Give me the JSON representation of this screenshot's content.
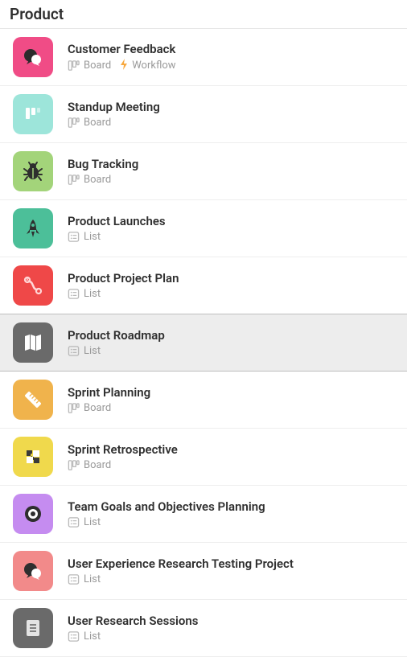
{
  "section_title": "Product",
  "view_labels": {
    "board": "Board",
    "list": "List",
    "workflow": "Workflow"
  },
  "items": [
    {
      "title": "Customer Feedback",
      "view": "board",
      "workflow": true,
      "icon": "chat-bubbles",
      "bg": "#f04c86",
      "fg": "#2b2b2b",
      "selected": false
    },
    {
      "title": "Standup Meeting",
      "view": "board",
      "workflow": false,
      "icon": "kanban-columns",
      "bg": "#9de5da",
      "fg": "#ffffff",
      "selected": false
    },
    {
      "title": "Bug Tracking",
      "view": "board",
      "workflow": false,
      "icon": "bug",
      "bg": "#a3d47a",
      "fg": "#2e2e2e",
      "selected": false
    },
    {
      "title": "Product Launches",
      "view": "list",
      "workflow": false,
      "icon": "rocket",
      "bg": "#4cbf99",
      "fg": "#2e2e2e",
      "selected": false
    },
    {
      "title": "Product Project Plan",
      "view": "list",
      "workflow": false,
      "icon": "merge-path",
      "bg": "#ef4848",
      "fg": "#ffd7d7",
      "selected": false
    },
    {
      "title": "Product Roadmap",
      "view": "list",
      "workflow": false,
      "icon": "map",
      "bg": "#6a6a6a",
      "fg": "#ffffff",
      "selected": true
    },
    {
      "title": "Sprint Planning",
      "view": "board",
      "workflow": false,
      "icon": "ruler",
      "bg": "#f0b34c",
      "fg": "#ffffff",
      "selected": false
    },
    {
      "title": "Sprint Retrospective",
      "view": "board",
      "workflow": false,
      "icon": "puzzle",
      "bg": "#f0d94c",
      "fg": "#3a3a3a",
      "selected": false
    },
    {
      "title": "Team Goals and Objectives Planning",
      "view": "list",
      "workflow": false,
      "icon": "target",
      "bg": "#c58cf0",
      "fg": "#2e2e2e",
      "selected": false
    },
    {
      "title": "User Experience Research Testing Project",
      "view": "list",
      "workflow": false,
      "icon": "chat-bubbles",
      "bg": "#f28a8a",
      "fg": "#2e2e2e",
      "selected": false
    },
    {
      "title": "User Research Sessions",
      "view": "list",
      "workflow": false,
      "icon": "clipboard",
      "bg": "#6a6a6a",
      "fg": "#e4e4e4",
      "selected": false
    }
  ]
}
